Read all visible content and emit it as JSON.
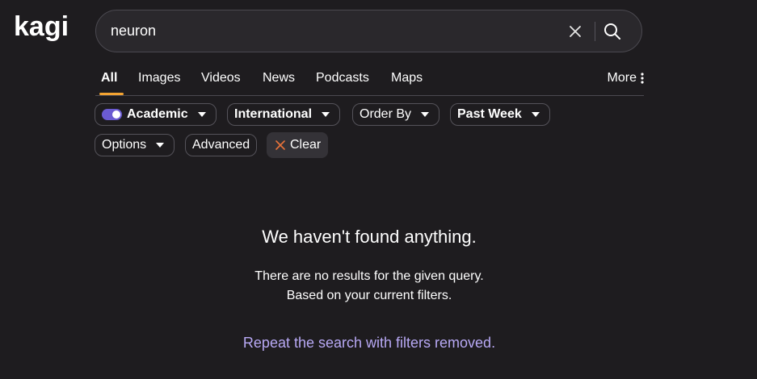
{
  "logo": {
    "text": "kagi"
  },
  "search": {
    "value": "neuron",
    "placeholder": ""
  },
  "icons": {
    "clear": "close-icon",
    "search": "search-icon",
    "more": "vertical-dots-icon",
    "dropdown": "caret-down-icon",
    "clear_filters": "x-icon"
  },
  "tabs": [
    {
      "label": "All",
      "active": true
    },
    {
      "label": "Images",
      "active": false
    },
    {
      "label": "Videos",
      "active": false
    },
    {
      "label": "News",
      "active": false
    },
    {
      "label": "Podcasts",
      "active": false
    },
    {
      "label": "Maps",
      "active": false
    }
  ],
  "more_label": "More",
  "filters": {
    "academic": {
      "label": "Academic",
      "enabled": true
    },
    "region": {
      "label": "International"
    },
    "order": {
      "label": "Order By"
    },
    "time": {
      "label": "Past Week"
    },
    "options": {
      "label": "Options"
    },
    "advanced": {
      "label": "Advanced"
    },
    "clear": {
      "label": "Clear"
    }
  },
  "empty_state": {
    "title": "We haven't found anything.",
    "line1": "There are no results for the given query.",
    "line2": "Based on your current filters.",
    "link": "Repeat the search with filters removed."
  },
  "colors": {
    "background": "#1e1c1f",
    "accent_underline": "#f4a432",
    "toggle": "#6b5bd2",
    "link": "#b8a9f5",
    "clear_x": "#e8733a"
  }
}
